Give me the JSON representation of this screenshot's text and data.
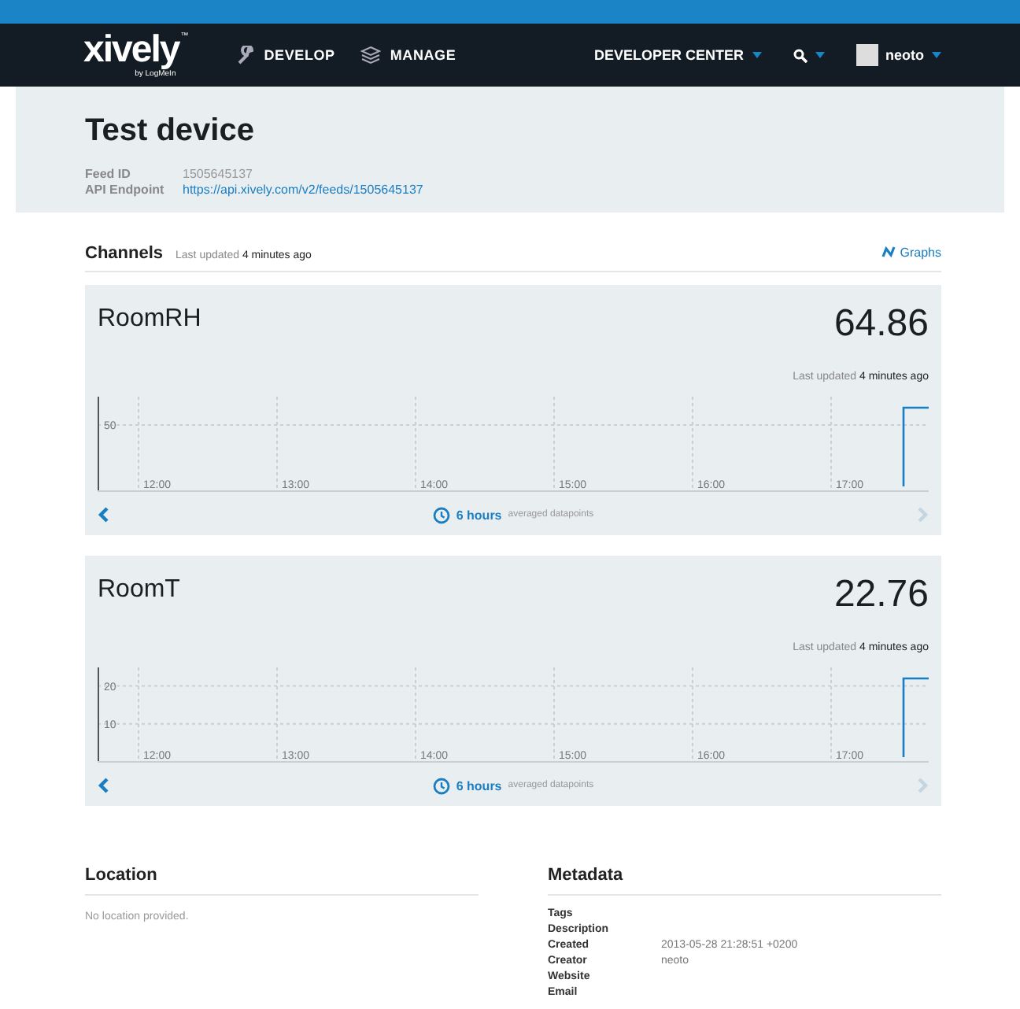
{
  "nav": {
    "logo": "xively",
    "logo_sub": "by LogMeIn",
    "logo_tm": "™",
    "items": [
      {
        "label": "DEVELOP",
        "kind": "wrench"
      },
      {
        "label": "MANAGE",
        "kind": "layers"
      }
    ],
    "developer_center": "DEVELOPER CENTER",
    "user": "neoto"
  },
  "device": {
    "title": "Test device",
    "fields": [
      {
        "label": "Feed ID",
        "value": "1505645137",
        "kind": "text"
      },
      {
        "label": "API Endpoint",
        "value": "https://api.xively.com/v2/feeds/1505645137",
        "kind": "link"
      }
    ]
  },
  "channels_section": {
    "title": "Channels",
    "updated_prefix": "Last updated",
    "updated_value": "4 minutes ago",
    "graphs_link": "Graphs"
  },
  "channels": [
    {
      "name": "RoomRH",
      "value": "64.86",
      "updated_prefix": "Last updated",
      "updated_value": "4 minutes ago",
      "y_ticks": [
        "50"
      ],
      "x_ticks": [
        "12:00",
        "13:00",
        "14:00",
        "15:00",
        "16:00",
        "17:00"
      ],
      "range": "6 hours",
      "range_note": "averaged datapoints",
      "prev_disabled": false,
      "next_disabled": true
    },
    {
      "name": "RoomT",
      "value": "22.76",
      "updated_prefix": "Last updated",
      "updated_value": "4 minutes ago",
      "y_ticks": [
        "20",
        "10"
      ],
      "x_ticks": [
        "12:00",
        "13:00",
        "14:00",
        "15:00",
        "16:00",
        "17:00"
      ],
      "range": "6 hours",
      "range_note": "averaged datapoints",
      "prev_disabled": false,
      "next_disabled": true
    }
  ],
  "location": {
    "title": "Location",
    "text": "No location provided."
  },
  "metadata": {
    "title": "Metadata",
    "rows": [
      {
        "label": "Tags"
      },
      {
        "label": "Description"
      },
      {
        "label": "Created",
        "value": "2013-05-28 21:28:51 +0200"
      },
      {
        "label": "Creator",
        "value": "neoto"
      },
      {
        "label": "Website"
      },
      {
        "label": "Email"
      }
    ]
  }
}
